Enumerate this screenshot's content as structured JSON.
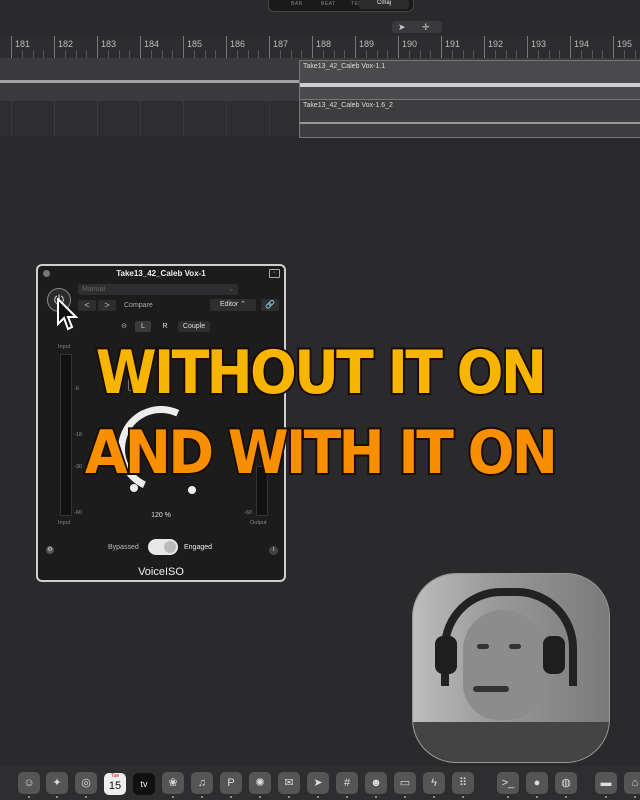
{
  "transport": {
    "bar": "BAR",
    "beat": "BEAT",
    "tempo": "TEMPO",
    "key": "Cmaj"
  },
  "ruler": {
    "bars": [
      "181",
      "182",
      "183",
      "184",
      "185",
      "186",
      "187",
      "188",
      "189",
      "190",
      "191",
      "192",
      "193",
      "194",
      "195"
    ]
  },
  "regions": [
    {
      "label": "Take13_42_Caleb Vox-1.1"
    },
    {
      "label": "Take13_42_Caleb Vox-1.6_2"
    }
  ],
  "plugin": {
    "title": "Take13_42_Caleb Vox-1",
    "preset": "Manual",
    "nav_prev": "<",
    "nav_next": ">",
    "compare": "Compare",
    "editor": "Editor",
    "link_icon": "🔗",
    "channel_buttons": {
      "l": "L",
      "r": "R",
      "couple": "Couple"
    },
    "input_label": "Input",
    "input_label_bottom": "Input",
    "output_label": "Output",
    "meter_scale_left": [
      "-6",
      "-18",
      "-30",
      "-60"
    ],
    "meter_scale_right": [
      "-60"
    ],
    "percent": "120 %",
    "bypassed": "Bypassed",
    "engaged": "Engaged",
    "engaged_state": true,
    "name": "VoiceISO",
    "partial_v": "V",
    "partial_l": "L",
    "info": "i"
  },
  "caption": {
    "line1": "WITHOUT IT ON",
    "line2": "AND WITH IT ON"
  },
  "dock": {
    "calendar_day": "15",
    "calendar_month": "Tue",
    "tv_label": "tv"
  }
}
